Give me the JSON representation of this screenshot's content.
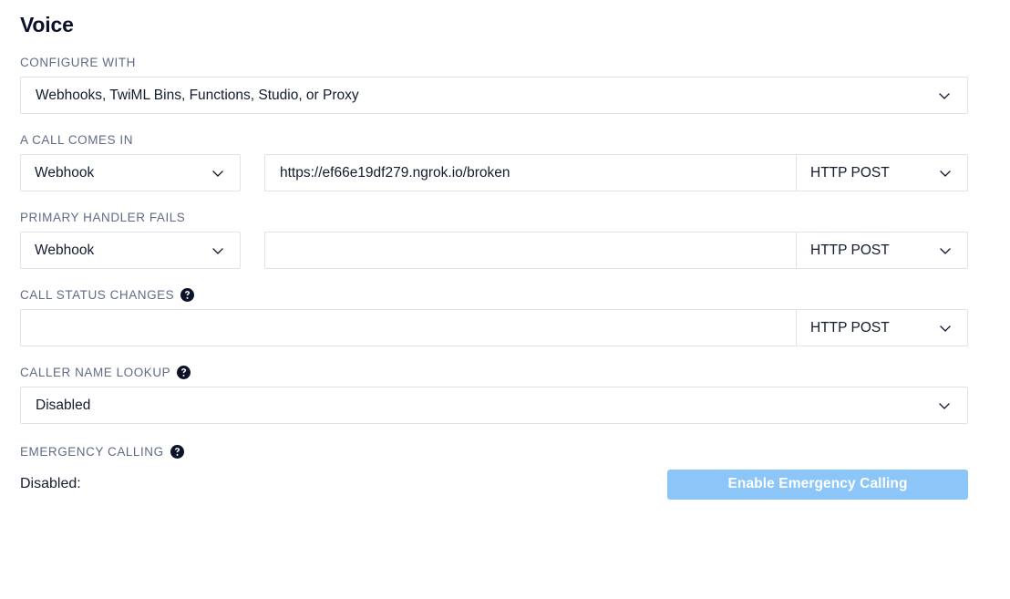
{
  "page": {
    "title": "Voice"
  },
  "configure_with": {
    "label": "CONFIGURE WITH",
    "value": "Webhooks, TwiML Bins, Functions, Studio, or Proxy",
    "chevron_icon": "chevron-down-icon"
  },
  "a_call_comes_in": {
    "label": "A CALL COMES IN",
    "handler": "Webhook",
    "url": "https://ef66e19df279.ngrok.io/broken",
    "url_placeholder": "",
    "method": "HTTP POST"
  },
  "primary_handler_fails": {
    "label": "PRIMARY HANDLER FAILS",
    "handler": "Webhook",
    "url": "",
    "url_placeholder": "",
    "method": "HTTP POST"
  },
  "call_status_changes": {
    "label": "CALL STATUS CHANGES",
    "help_icon": "help-circle-icon",
    "url": "",
    "url_placeholder": "",
    "method": "HTTP POST"
  },
  "caller_name_lookup": {
    "label": "CALLER NAME LOOKUP",
    "help_icon": "help-circle-icon",
    "value": "Disabled"
  },
  "emergency_calling": {
    "label": "EMERGENCY CALLING",
    "help_icon": "help-circle-icon",
    "status": "Disabled:",
    "button_label": "Enable Emergency Calling"
  },
  "colors": {
    "accent_button": "#8cc6f9",
    "label_gray": "#606b85",
    "border": "#e1e3ea",
    "text_dark": "#121c2d",
    "help_icon_navy": "#0d122b"
  }
}
